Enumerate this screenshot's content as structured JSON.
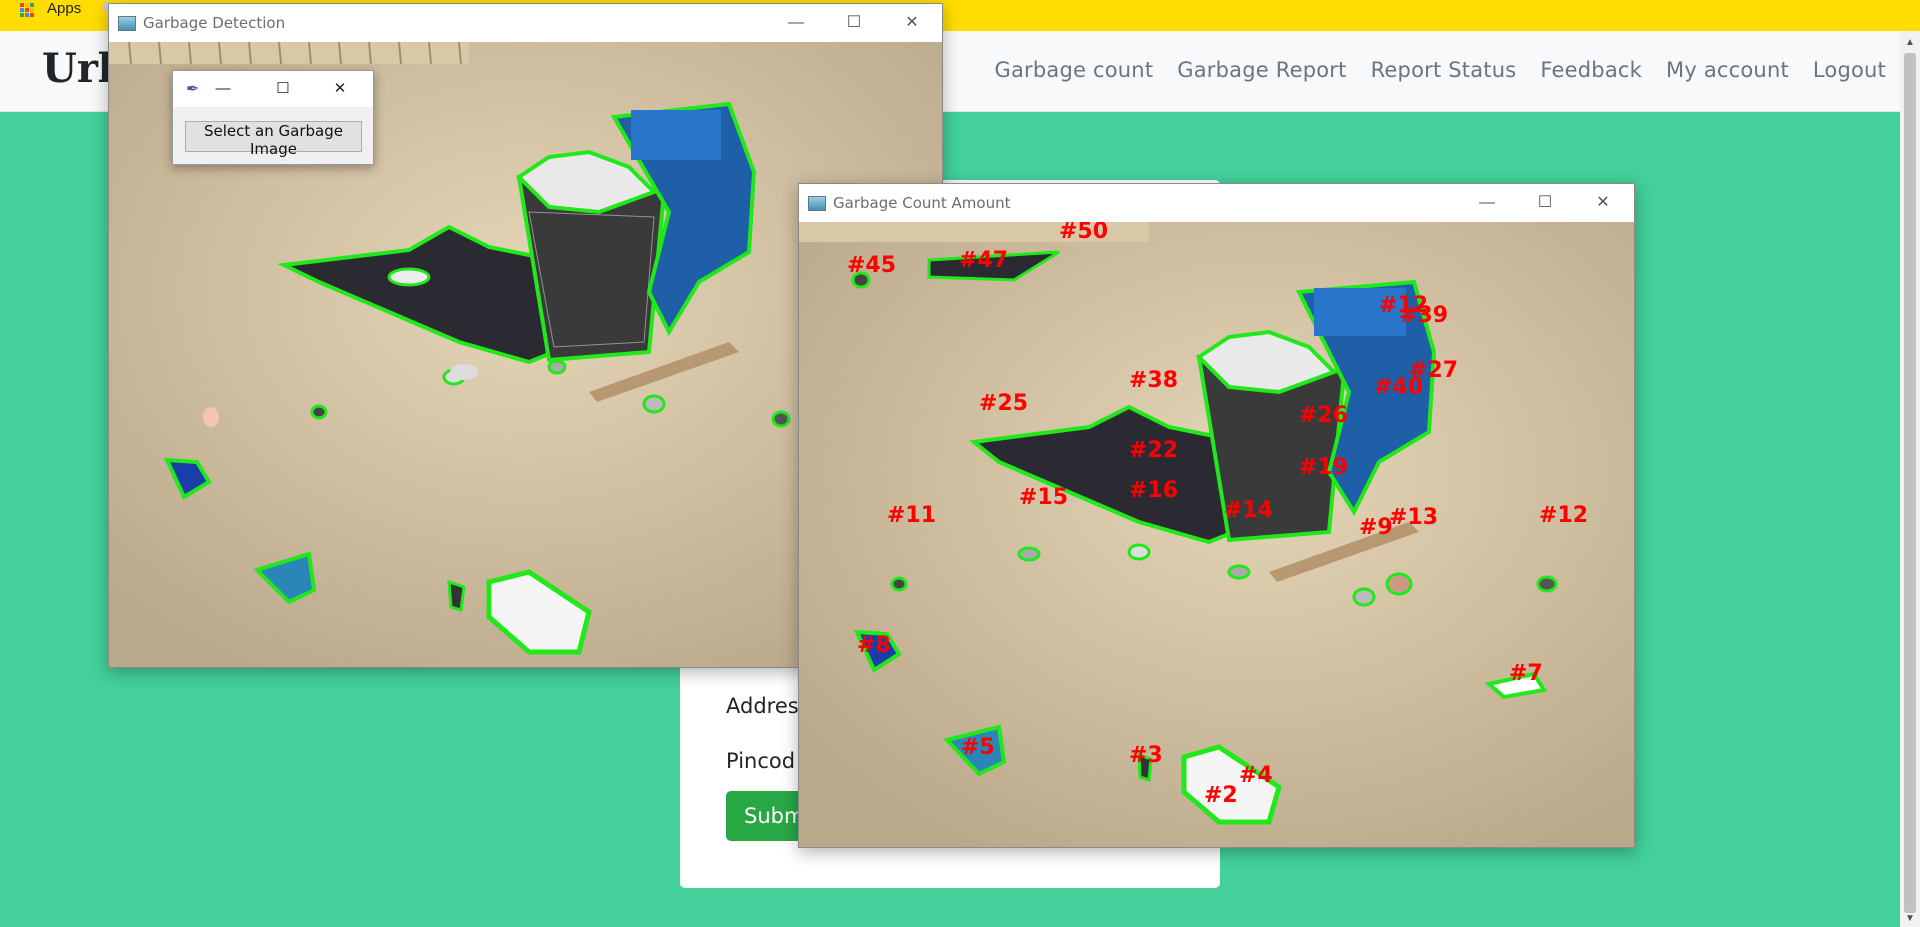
{
  "bookmarks": {
    "apps_label": "Apps"
  },
  "site": {
    "brand": "Urb",
    "nav": [
      "Garbage count",
      "Garbage Report",
      "Report Status",
      "Feedback",
      "My account",
      "Logout"
    ]
  },
  "form": {
    "address_label": "Addres",
    "pincode_label": "Pincod",
    "submit_label": "Subm"
  },
  "detection_window": {
    "title": "Garbage Detection",
    "controls": {
      "minimize": "—",
      "maximize": "☐",
      "close": "✕"
    }
  },
  "select_dialog": {
    "button_label": "Select an Garbage Image",
    "controls": {
      "minimize": "—",
      "maximize": "☐",
      "close": "✕"
    }
  },
  "count_window": {
    "title": "Garbage Count Amount",
    "controls": {
      "minimize": "—",
      "maximize": "☐",
      "close": "✕"
    },
    "labels": [
      "#45",
      "#47",
      "#50",
      "#38",
      "#40",
      "#27",
      "#39",
      "#12",
      "#25",
      "#26",
      "#22",
      "#16",
      "#15",
      "#11",
      "#14",
      "#19",
      "#9",
      "#13",
      "#12",
      "#8",
      "#7",
      "#5",
      "#3",
      "#4",
      "#2"
    ]
  },
  "colors": {
    "bookmarks_bar": "#ffdd00",
    "page_bg": "#43d09a",
    "contour": "#21e81b",
    "label": "#ff0000",
    "submit": "#28a745"
  }
}
